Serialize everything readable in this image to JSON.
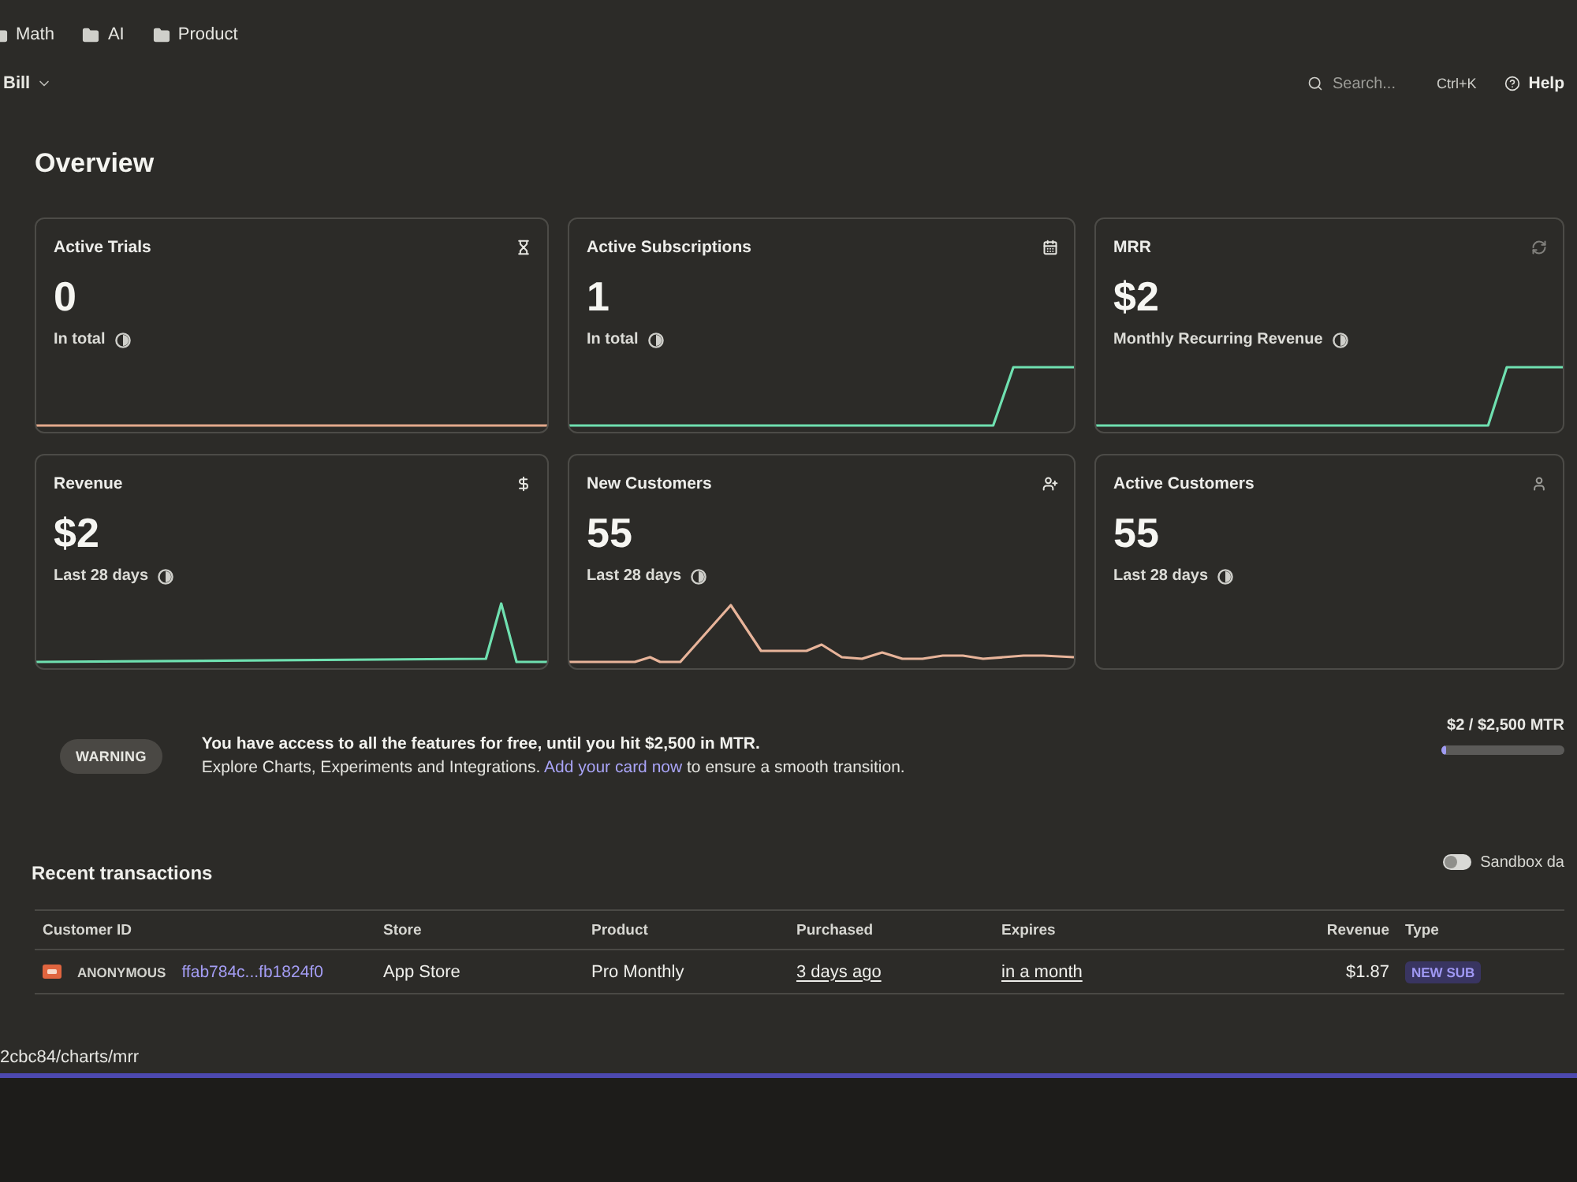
{
  "bookmarks": [
    {
      "label": "Math"
    },
    {
      "label": "AI"
    },
    {
      "label": "Product"
    }
  ],
  "header": {
    "project": "Bill",
    "search": {
      "placeholder": "Search..."
    },
    "shortcut": "Ctrl+K",
    "help": "Help"
  },
  "title": "Overview",
  "cards": [
    {
      "title": "Active Trials",
      "value": "0",
      "caption": "In total",
      "kind": "flat",
      "color": "#e3a98c"
    },
    {
      "title": "Active Subscriptions",
      "value": "1",
      "caption": "In total",
      "kind": "step",
      "color": "#6fe0b0"
    },
    {
      "title": "MRR",
      "value": "$2",
      "caption": "Monthly Recurring Revenue",
      "kind": "step",
      "color": "#6fe0b0"
    },
    {
      "title": "Revenue",
      "value": "$2",
      "caption": "Last 28 days",
      "kind": "spike",
      "color": "#6fe0b0"
    },
    {
      "title": "New Customers",
      "value": "55",
      "caption": "Last 28 days",
      "kind": "wavy",
      "color": "#e8b49a"
    },
    {
      "title": "Active Customers",
      "value": "55",
      "caption": "Last 28 days",
      "kind": "plain"
    }
  ],
  "warning": {
    "badge": "WARNING",
    "headline": "You have access to all the features for free, until you hit $2,500 in MTR.",
    "text_before": "Explore Charts, Experiments and Integrations.",
    "link": "Add your card now",
    "text_after": "to ensure a smooth transition.",
    "usage": {
      "label": "$2 / $2,500 MTR",
      "level": 0.001
    }
  },
  "transactions": {
    "title": "Recent transactions",
    "sandbox": {
      "label": "Sandbox da",
      "on": false
    },
    "columns": [
      "Customer ID",
      "Store",
      "Product",
      "Purchased",
      "Expires",
      "Revenue",
      "Type"
    ],
    "rows": [
      {
        "customer_label": "ANONYMOUS",
        "customer_id": "ffab784c...fb1824f0",
        "store": "App Store",
        "product": "Pro Monthly",
        "purchased": "3 days ago",
        "expires": "in a month",
        "revenue": "$1.87",
        "type": "NEW SUB"
      }
    ]
  },
  "status_bar": {
    "url": "2cbc84/charts/mrr"
  }
}
